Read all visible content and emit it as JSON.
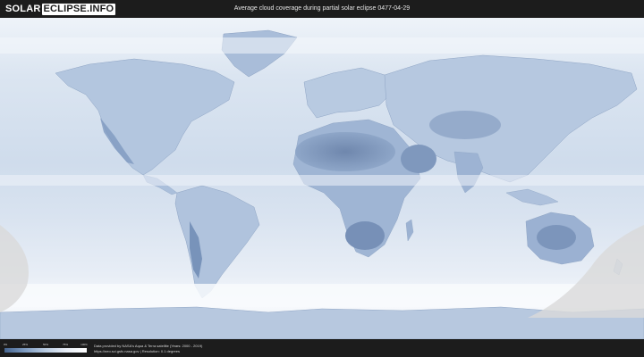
{
  "header": {
    "logo_part1": "SOLAR",
    "logo_part2": "ECLIPSE.INFO",
    "title": "Average cloud coverage during partial solar eclipse 0477-04-29"
  },
  "legend": {
    "ticks": [
      "0%",
      "25%",
      "50%",
      "75%",
      "100%"
    ],
    "colors": [
      "#46658f",
      "#7f9cc1",
      "#b9cbe1",
      "#e8eef6",
      "#ffffff"
    ]
  },
  "credits": {
    "line1": "Data provided by NASA's Aqua & Terra satellite (Years: 2000 - 2019)",
    "line2": "https://neo.sci.gsfc.nasa.gov | Resolution: 0.1 degrees"
  },
  "map": {
    "ocean_color": "#d4e0ef",
    "land_color": "#9bb2d2",
    "cloud_color": "#f2f6fb",
    "eclipse_zone_color": "#d9d9d9"
  }
}
